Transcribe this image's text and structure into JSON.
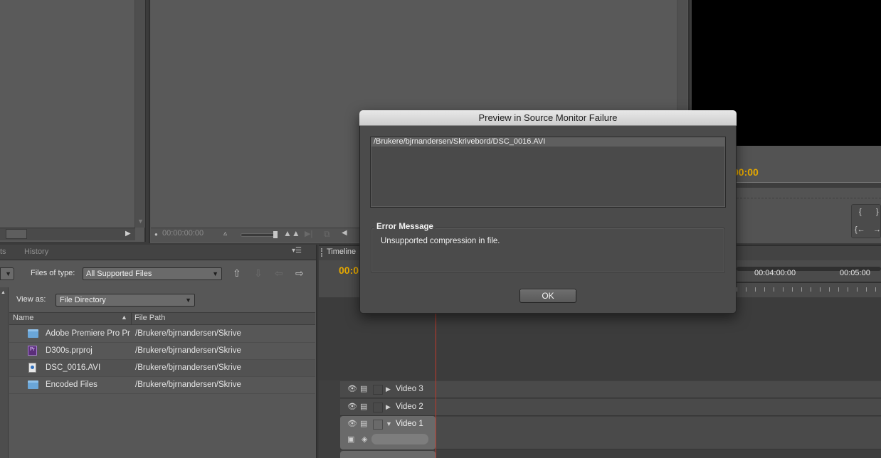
{
  "source_monitor": {
    "timecode": "00:00:00:00"
  },
  "program_monitor": {
    "timecode": "00:00"
  },
  "media_browser": {
    "tabs": [
      "ts",
      "History"
    ],
    "files_of_type_label": "Files of type:",
    "files_of_type_value": "All Supported Files",
    "view_as_label": "View as:",
    "view_as_value": "File Directory",
    "columns": {
      "name": "Name",
      "path": "File Path"
    },
    "rows": [
      {
        "icon": "folder-icon",
        "name": "Adobe Premiere Pro Pr",
        "path": "/Brukere/bjrnandersen/Skrive"
      },
      {
        "icon": "premiere-project-icon",
        "name": "D300s.prproj",
        "path": "/Brukere/bjrnandersen/Skrive"
      },
      {
        "icon": "avi-file-icon",
        "name": "DSC_0016.AVI",
        "path": "/Brukere/bjrnandersen/Skrive"
      },
      {
        "icon": "folder-icon",
        "name": "Encoded Files",
        "path": "/Brukere/bjrnandersen/Skrive"
      }
    ]
  },
  "timeline": {
    "tab_label": "Timeline",
    "timecode": "00:0",
    "time_marks": [
      "00:04:00:00",
      "00:05:00"
    ],
    "tracks": [
      "Video 3",
      "Video 2",
      "Video 1"
    ]
  },
  "dialog": {
    "title": "Preview in Source Monitor Failure",
    "file_path": "/Brukere/bjrnandersen/Skrivebord/DSC_0016.AVI",
    "error_label": "Error Message",
    "error_text": "Unsupported compression in file.",
    "ok_label": "OK"
  },
  "colors": {
    "timecode": "#e5a800",
    "playhead": "#c0392b",
    "panel": "#575757"
  }
}
